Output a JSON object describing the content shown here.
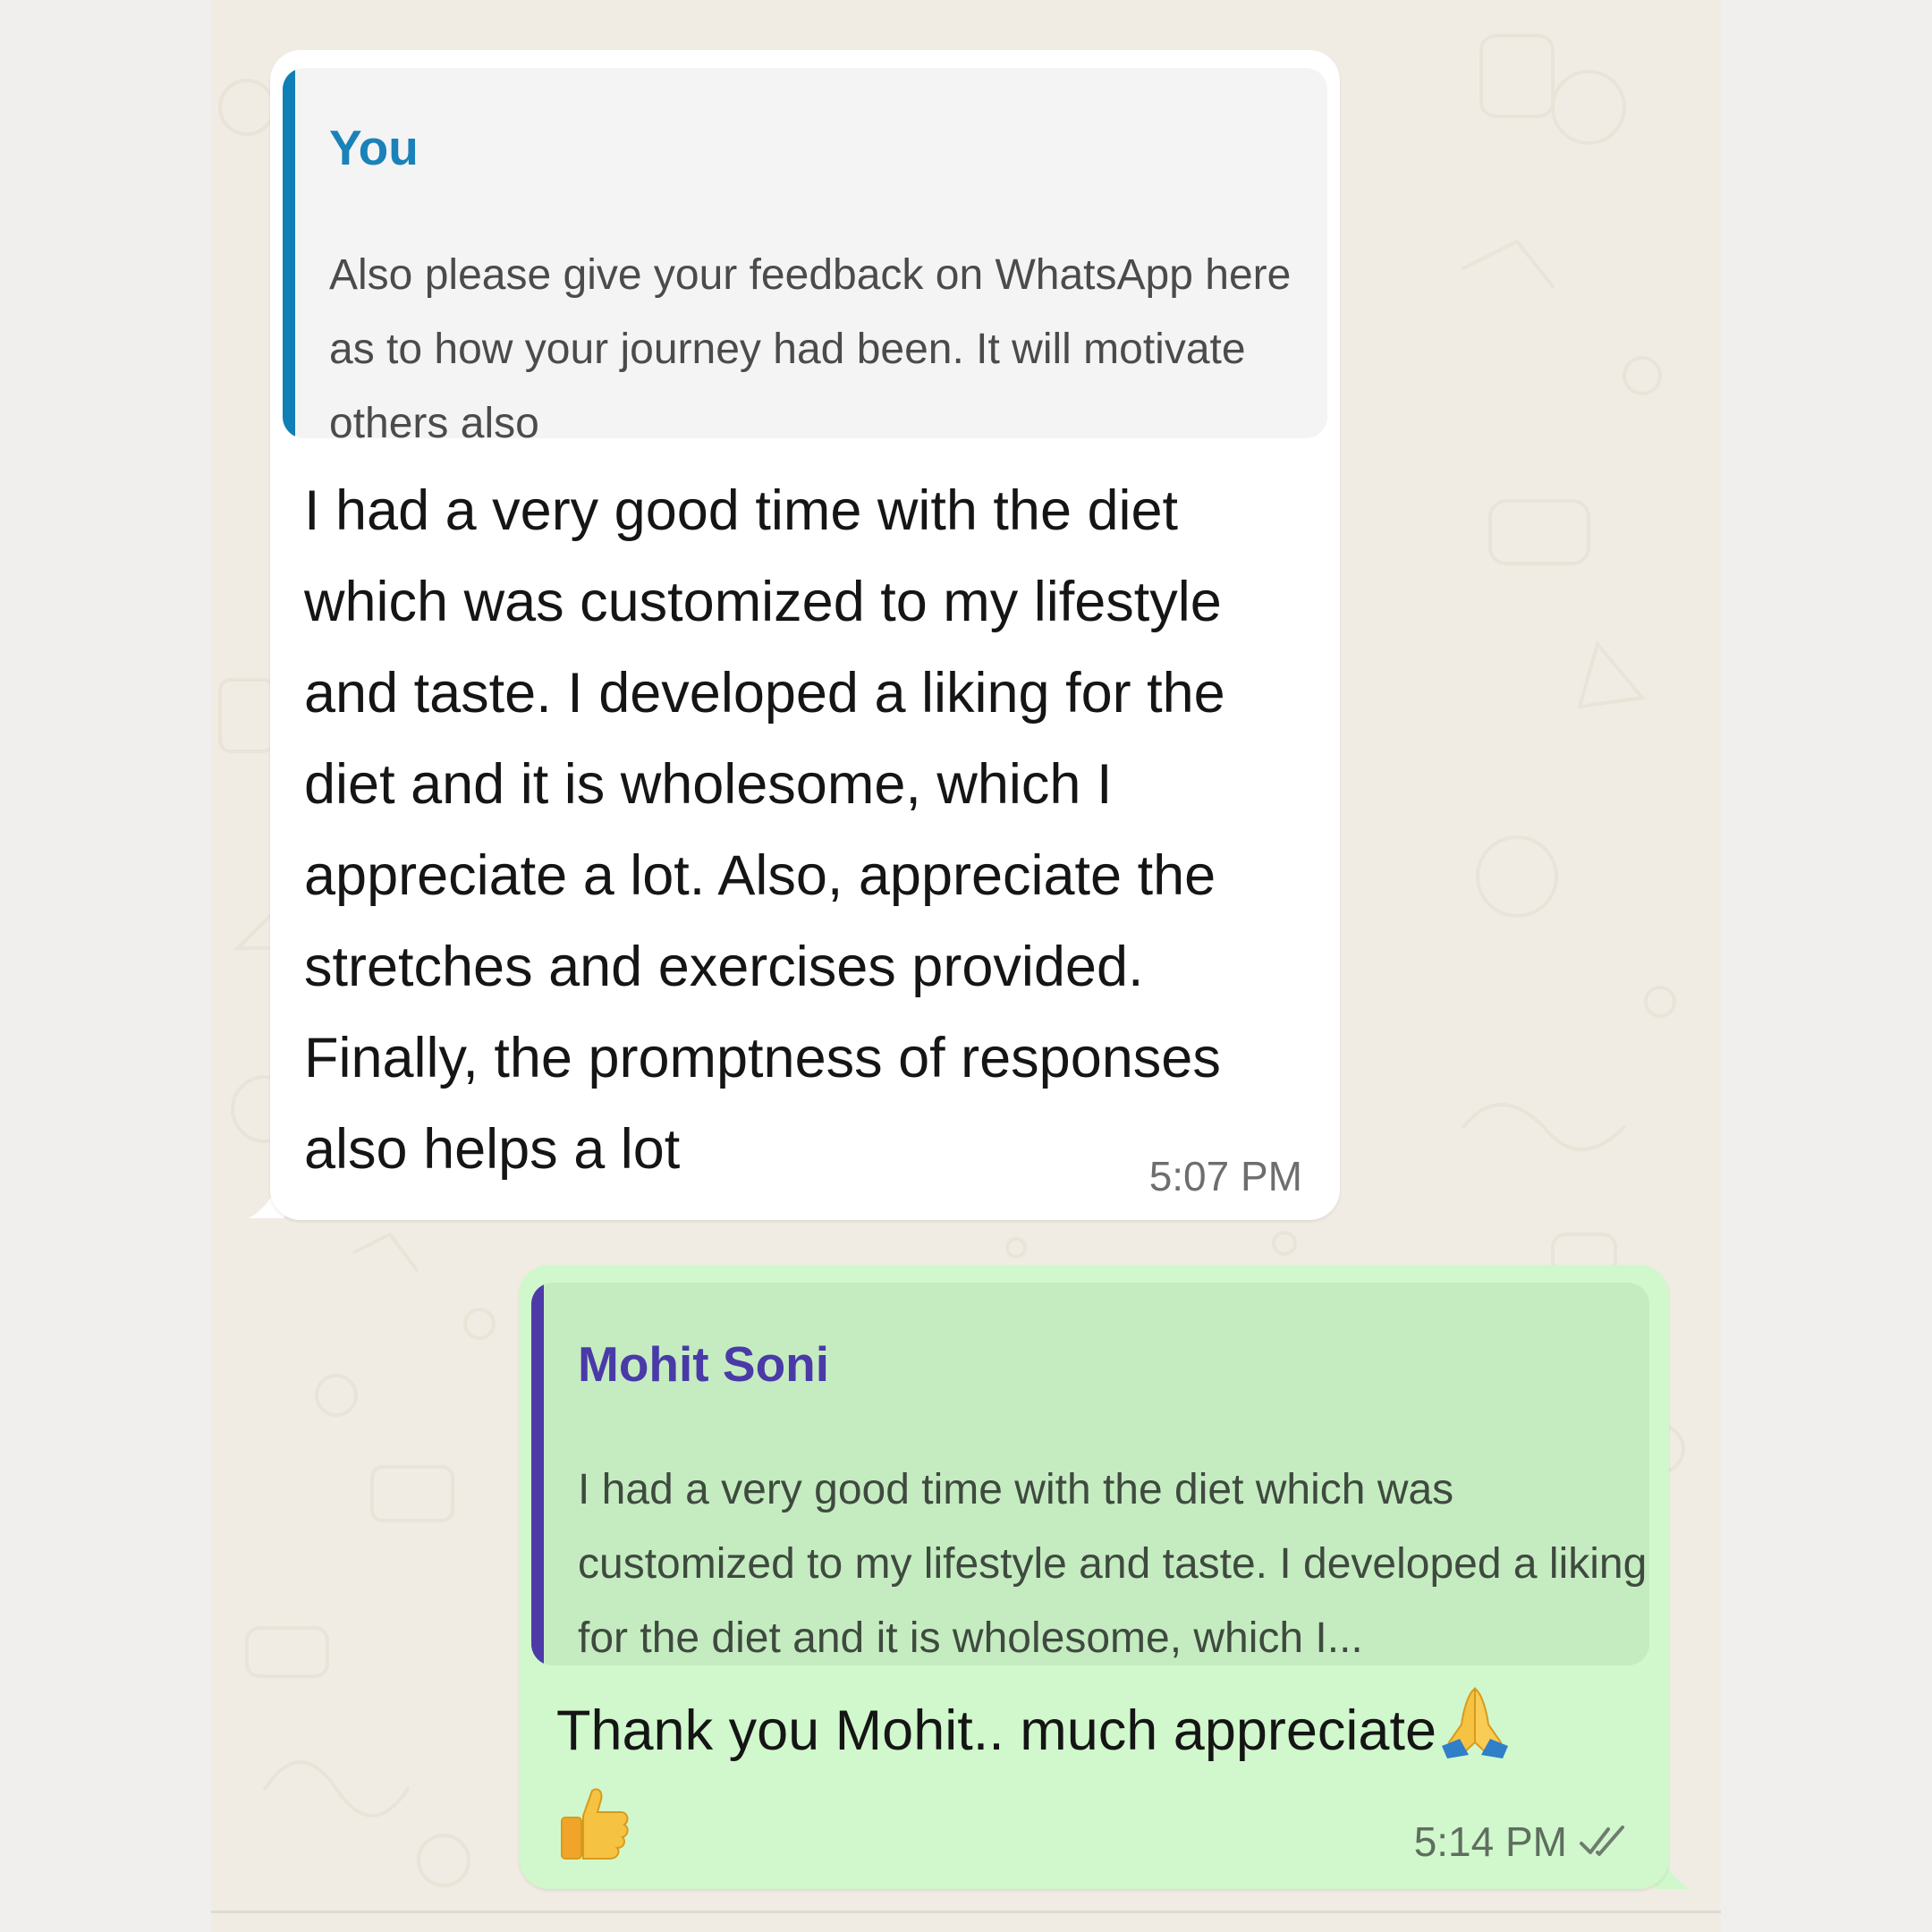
{
  "messages": {
    "incoming": {
      "quote_author": "You",
      "quote_text": "Also please give your feedback on WhatsApp here as to how your journey had been. It will motivate others also",
      "body": "I had a very good time with the diet which was customized to my lifestyle and taste. I developed a liking for the diet and it is wholesome, which I appreciate a lot. Also, appreciate the stretches and exercises provided. Finally, the promptness of responses also helps a lot",
      "time": "5:07 PM"
    },
    "outgoing": {
      "quote_author": "Mohit Soni",
      "quote_text": "I had a very good time with the diet which was customized to my lifestyle and taste. I developed a liking for the diet and it is wholesome, which I...",
      "body": "Thank you Mohit.. much appreciate",
      "emoji_inline": "folded-hands-emoji",
      "emoji_line": "thumbs-up-emoji",
      "time": "5:14 PM",
      "status_icon": "double-check-icon"
    }
  },
  "colors": {
    "incoming_quote_bar": "#0f7fb6",
    "incoming_quote_author": "#1a82b9",
    "outgoing_bubble": "#d0f8cc",
    "outgoing_quote_bar": "#4d3aa8",
    "outgoing_quote_author": "#4a3aa8",
    "chat_background": "#f1ece3"
  }
}
